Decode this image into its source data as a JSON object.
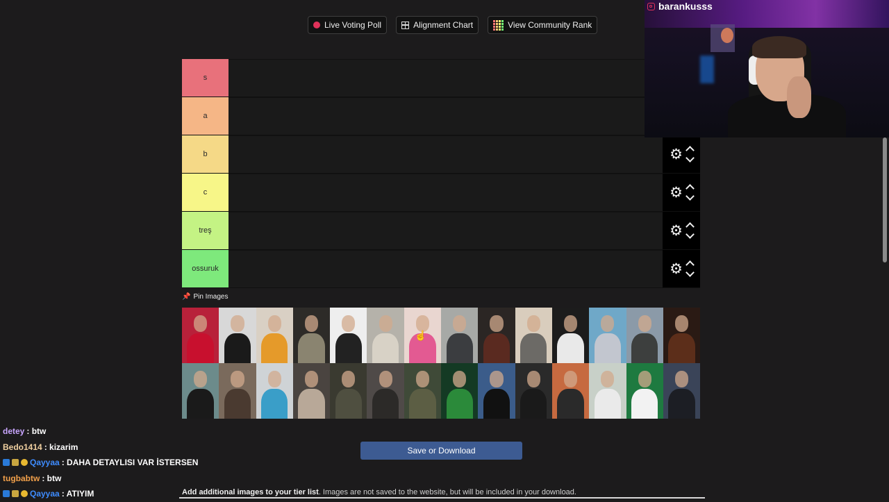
{
  "toolbar": {
    "live_voting": "Live Voting Poll",
    "alignment": "Alignment Chart",
    "community_rank": "View Community Rank"
  },
  "tiers": [
    {
      "label": "s",
      "color": "#e8717b"
    },
    {
      "label": "a",
      "color": "#f5b686"
    },
    {
      "label": "b",
      "color": "#f5d987"
    },
    {
      "label": "c",
      "color": "#f7f688"
    },
    {
      "label": "treş",
      "color": "#c4f384"
    },
    {
      "label": "ossuruk",
      "color": "#7ee97c"
    }
  ],
  "pin_label": "Pin Images",
  "image_pool": [
    {
      "bg": "#b8213a",
      "shirt": "#c8102e"
    },
    {
      "bg": "#d8d8d8",
      "shirt": "#1a1a1a"
    },
    {
      "bg": "#d9d0c4",
      "shirt": "#e59a2a"
    },
    {
      "bg": "#2d2b28",
      "shirt": "#8a8470"
    },
    {
      "bg": "#eeeeee",
      "shirt": "#222222"
    },
    {
      "bg": "#b5b2aa",
      "shirt": "#d8d2c6"
    },
    {
      "bg": "#e9d6d0",
      "shirt": "#e35a92"
    },
    {
      "bg": "#a7a9a6",
      "shirt": "#3b3d40"
    },
    {
      "bg": "#2b2624",
      "shirt": "#5a2a20"
    },
    {
      "bg": "#d9cdbd",
      "shirt": "#6c6a66"
    },
    {
      "bg": "#1c1c1c",
      "shirt": "#e9e9e9"
    },
    {
      "bg": "#6fa8c8",
      "shirt": "#c2c6cf"
    },
    {
      "bg": "#8b9aa8",
      "shirt": "#3d3f3e"
    },
    {
      "bg": "#2a1a14",
      "shirt": "#5c2e1a"
    },
    {
      "bg": "#6c8b8b",
      "shirt": "#1a1a1a"
    },
    {
      "bg": "#7a6a5c",
      "shirt": "#4a3a30"
    },
    {
      "bg": "#cfd3d6",
      "shirt": "#3a9ec8"
    },
    {
      "bg": "#4a4440",
      "shirt": "#b8a898"
    },
    {
      "bg": "#3a3a30",
      "shirt": "#4f4f40"
    },
    {
      "bg": "#4f4a48",
      "shirt": "#2c2a28"
    },
    {
      "bg": "#3f4a38",
      "shirt": "#5c5e44"
    },
    {
      "bg": "#143a24",
      "shirt": "#2b8a3a"
    },
    {
      "bg": "#3b5c8a",
      "shirt": "#111111"
    },
    {
      "bg": "#2a2a2a",
      "shirt": "#1a1a1a"
    },
    {
      "bg": "#c66a40",
      "shirt": "#2a2a2a"
    },
    {
      "bg": "#c8d0c8",
      "shirt": "#eaeaea"
    },
    {
      "bg": "#1e7a40",
      "shirt": "#f2f2f2"
    },
    {
      "bg": "#3a4458",
      "shirt": "#1c1e24"
    }
  ],
  "save_button": "Save or Download",
  "footer": {
    "bold": "Add additional images to your tier list",
    "rest": ". Images are not saved to the website, but will be included in your download."
  },
  "chat": [
    {
      "user": "detey",
      "color": "#c9a6ff",
      "msg": ": btw",
      "badges": false
    },
    {
      "user": "Bedo1414",
      "color": "#f0d0a0",
      "msg": ": kizarim",
      "badges": false
    },
    {
      "user": "Qayyaa",
      "color": "#3e8cff",
      "msg": ": DAHA DETAYLISI VAR İSTERSEN",
      "badges": true
    },
    {
      "user": "tugbabtw",
      "color": "#f2a04a",
      "msg": ": btw",
      "badges": false
    },
    {
      "user": "Qayyaa",
      "color": "#3e8cff",
      "msg": ": ATIYIM",
      "badges": true
    }
  ],
  "streamer": "barankusss"
}
